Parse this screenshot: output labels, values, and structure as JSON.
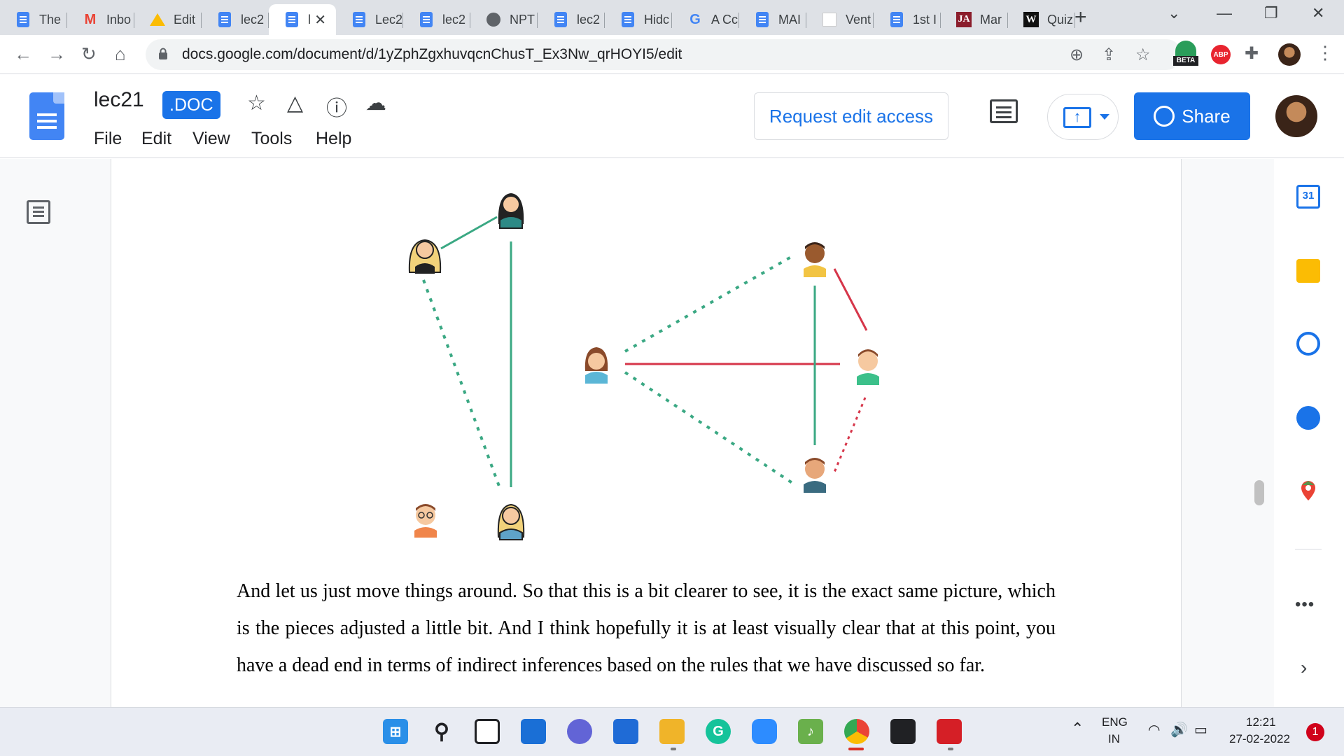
{
  "tabs": [
    {
      "label": "The",
      "icon": "docs-icon"
    },
    {
      "label": "Inbo",
      "icon": "gmail-icon"
    },
    {
      "label": "Edit",
      "icon": "drive-icon"
    },
    {
      "label": "lec2",
      "icon": "docs-icon"
    },
    {
      "label": "l",
      "icon": "docs-icon",
      "active": true
    },
    {
      "label": "Lec2",
      "icon": "docs-icon"
    },
    {
      "label": "lec2",
      "icon": "docs-icon"
    },
    {
      "label": "NPT",
      "icon": "globe-icon"
    },
    {
      "label": "lec2",
      "icon": "docs-icon"
    },
    {
      "label": "Hidc",
      "icon": "docs-icon"
    },
    {
      "label": "A Cc",
      "icon": "google-icon"
    },
    {
      "label": "MAI",
      "icon": "docs-icon"
    },
    {
      "label": "Vent",
      "icon": "blank-icon"
    },
    {
      "label": "1st I",
      "icon": "docs-icon"
    },
    {
      "label": "Mar",
      "icon": "ja-icon"
    },
    {
      "label": "Quiz",
      "icon": "w-icon"
    }
  ],
  "omnibox": {
    "url": "docs.google.com/document/d/1yZphZgxhuvqcnChusT_Ex3Nw_qrHOYI5/edit",
    "beta_badge": "BETA",
    "abp_badge": "ABP"
  },
  "docs": {
    "title": "lec21",
    "badge": ".DOC",
    "menus": [
      "File",
      "Edit",
      "View",
      "Tools",
      "Help"
    ],
    "request_edit": "Request edit access",
    "share": "Share"
  },
  "document": {
    "paragraph": "And let us just move things around. So that this is a bit clearer to see, it is the exact same picture, which is the pieces adjusted a little bit. And I think hopefully it is at least visually clear that at this point, you have a dead end in terms of indirect inferences based on the rules that we have discussed so far."
  },
  "sidepanel": {
    "calendar_day": "31",
    "more": "•••"
  },
  "taskbar": {
    "lang_top": "ENG",
    "lang_bottom": "IN",
    "time": "12:21",
    "date": "27-02-2022",
    "notifications": "1"
  },
  "colors": {
    "accent": "#1a73e8",
    "edge_green": "#3aa883",
    "edge_red": "#d6364a"
  }
}
